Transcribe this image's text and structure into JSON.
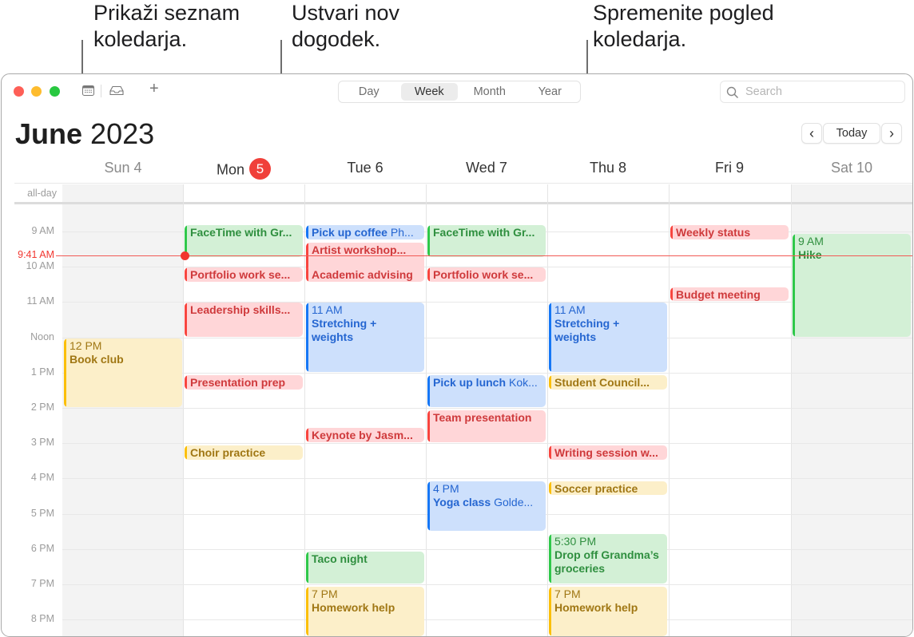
{
  "callouts": {
    "calendar_list": "Prikaži seznam\nkoledarja.",
    "new_event": "Ustvari nov\ndogodek.",
    "change_view": "Spremenite pogled\nkoledarja."
  },
  "toolbar": {
    "calendars_icon": "calendar-list-icon",
    "inbox_icon": "inbox-icon",
    "add_label": "+",
    "views": [
      "Day",
      "Week",
      "Month",
      "Year"
    ],
    "active_view": "Week",
    "search_placeholder": "Search"
  },
  "header": {
    "month": "June",
    "year": "2023",
    "prev_label": "‹",
    "today_label": "Today",
    "next_label": "›"
  },
  "days": [
    {
      "label": "Sun 4",
      "weekend": true
    },
    {
      "label": "Mon",
      "badge": "5",
      "today": true
    },
    {
      "label": "Tue 6"
    },
    {
      "label": "Wed 7"
    },
    {
      "label": "Thu 8"
    },
    {
      "label": "Fri 9"
    },
    {
      "label": "Sat 10",
      "weekend": true
    }
  ],
  "allday_label": "all-day",
  "hours": [
    "9 AM",
    "10 AM",
    "11 AM",
    "Noon",
    "1 PM",
    "2 PM",
    "3 PM",
    "4 PM",
    "5 PM",
    "6 PM",
    "7 PM",
    "8 PM"
  ],
  "current_time": "9:41 AM",
  "colors": {
    "red": "#f8453f",
    "green": "#2fc84a",
    "blue": "#1677f5",
    "yellow": "#fbbf0a",
    "today_badge": "#f0403a"
  },
  "events": [
    {
      "day": 0,
      "start": 12.0,
      "end": 14.0,
      "color": "yellow",
      "time": "12 PM",
      "name": "Book club"
    },
    {
      "day": 1,
      "start": 8.8,
      "end": 9.75,
      "color": "green",
      "name": "FaceTime with Gr..."
    },
    {
      "day": 1,
      "start": 10.0,
      "end": 10.45,
      "color": "red",
      "name": "Portfolio work se..."
    },
    {
      "day": 1,
      "start": 11.0,
      "end": 12.0,
      "color": "red",
      "name": "Leadership skills..."
    },
    {
      "day": 1,
      "start": 13.05,
      "end": 13.5,
      "color": "red",
      "name": "Presentation prep"
    },
    {
      "day": 1,
      "start": 15.05,
      "end": 15.5,
      "color": "yellow",
      "name": "Choir practice"
    },
    {
      "day": 2,
      "start": 8.8,
      "end": 9.25,
      "color": "blue",
      "name": "Pick up coffee",
      "location": "Ph..."
    },
    {
      "day": 2,
      "start": 9.3,
      "end": 10.25,
      "color": "red",
      "name": "Artist workshop..."
    },
    {
      "day": 2,
      "start": 10.0,
      "end": 10.45,
      "color": "red",
      "name": "Academic advising"
    },
    {
      "day": 2,
      "start": 11.0,
      "end": 13.0,
      "color": "blue",
      "time": "11 AM",
      "name": "Stretching + weights"
    },
    {
      "day": 2,
      "start": 14.55,
      "end": 15.0,
      "color": "red",
      "name": "Keynote by Jasm..."
    },
    {
      "day": 2,
      "start": 18.05,
      "end": 19.0,
      "color": "green",
      "name": "Taco night"
    },
    {
      "day": 2,
      "start": 19.05,
      "end": 20.5,
      "color": "yellow",
      "time": "7 PM",
      "name": "Homework help"
    },
    {
      "day": 3,
      "start": 8.8,
      "end": 9.75,
      "color": "green",
      "name": "FaceTime with Gr..."
    },
    {
      "day": 3,
      "start": 10.0,
      "end": 10.45,
      "color": "red",
      "name": "Portfolio work se..."
    },
    {
      "day": 3,
      "start": 13.05,
      "end": 14.0,
      "color": "blue",
      "name": "Pick up lunch",
      "location": "Kok..."
    },
    {
      "day": 3,
      "start": 14.05,
      "end": 15.0,
      "color": "red",
      "name": "Team presentation"
    },
    {
      "day": 3,
      "start": 16.05,
      "end": 17.5,
      "color": "blue",
      "time": "4 PM",
      "name": "Yoga class",
      "location": "Golde..."
    },
    {
      "day": 4,
      "start": 11.0,
      "end": 13.0,
      "color": "blue",
      "time": "11 AM",
      "name": "Stretching + weights"
    },
    {
      "day": 4,
      "start": 13.05,
      "end": 13.5,
      "color": "yellow",
      "name": "Student Council..."
    },
    {
      "day": 4,
      "start": 15.05,
      "end": 15.5,
      "color": "red",
      "name": "Writing session w..."
    },
    {
      "day": 4,
      "start": 16.05,
      "end": 16.5,
      "color": "yellow",
      "name": "Soccer practice"
    },
    {
      "day": 4,
      "start": 17.55,
      "end": 19.0,
      "color": "green",
      "time": "5:30 PM",
      "name": "Drop off Grandma’s groceries"
    },
    {
      "day": 4,
      "start": 19.05,
      "end": 20.5,
      "color": "yellow",
      "time": "7 PM",
      "name": "Homework help"
    },
    {
      "day": 5,
      "start": 8.8,
      "end": 9.25,
      "color": "red",
      "name": "Weekly status"
    },
    {
      "day": 5,
      "start": 10.55,
      "end": 11.0,
      "color": "red",
      "name": "Budget meeting"
    },
    {
      "day": 6,
      "start": 9.05,
      "end": 12.0,
      "color": "green",
      "time": "9 AM",
      "name": "Hike"
    }
  ]
}
